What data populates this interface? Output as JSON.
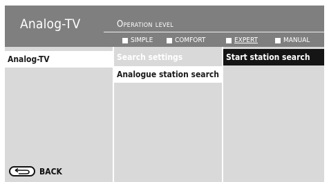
{
  "header": {
    "title": "Analog-TV",
    "operation_level_label": "Operation level",
    "levels": [
      {
        "label": "SIMPLE",
        "active": false
      },
      {
        "label": "COMFORT",
        "active": false
      },
      {
        "label": "EXPERT",
        "active": true
      },
      {
        "label": "MANUAL",
        "active": false
      }
    ]
  },
  "columns": {
    "col1": {
      "items": [
        "Analog-TV"
      ]
    },
    "col2": {
      "items": [
        "Search settings",
        "Analogue station search"
      ]
    },
    "col3": {
      "items": [
        "Start station search"
      ]
    }
  },
  "footer": {
    "back_label": "BACK",
    "back_icon": "return-arrow-icon"
  },
  "colors": {
    "header_bg": "#7f7f7f",
    "panel_bg": "#d9d9d9",
    "selected_dark": "#151515"
  }
}
